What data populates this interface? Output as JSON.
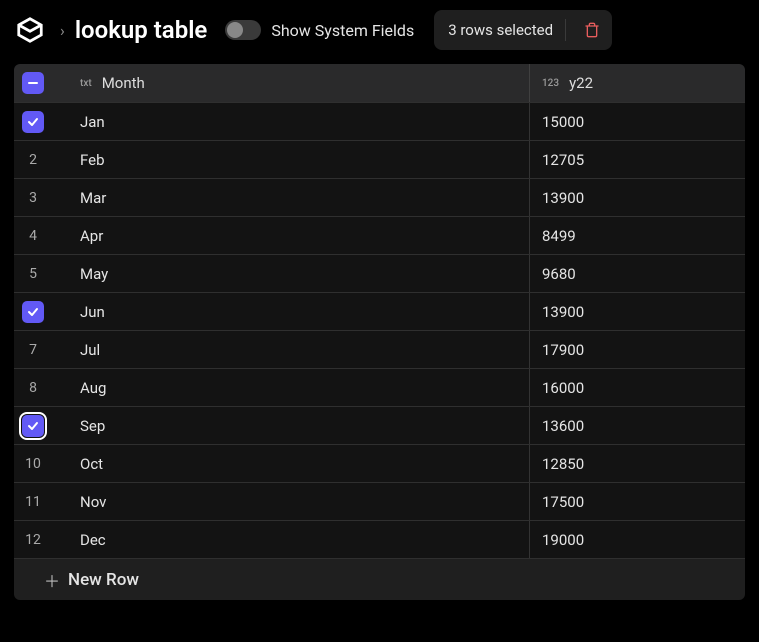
{
  "header": {
    "title": "lookup table",
    "toggle_label": "Show System Fields",
    "selection_text": "3 rows selected"
  },
  "columns": {
    "month": {
      "type_badge": "txt",
      "label": "Month"
    },
    "y22": {
      "type_badge": "123",
      "label": "y22"
    }
  },
  "rows": [
    {
      "idx": 1,
      "checked": true,
      "focused": false,
      "month": "Jan",
      "y22": "15000"
    },
    {
      "idx": 2,
      "checked": false,
      "focused": false,
      "month": "Feb",
      "y22": "12705"
    },
    {
      "idx": 3,
      "checked": false,
      "focused": false,
      "month": "Mar",
      "y22": "13900"
    },
    {
      "idx": 4,
      "checked": false,
      "focused": false,
      "month": "Apr",
      "y22": "8499"
    },
    {
      "idx": 5,
      "checked": false,
      "focused": false,
      "month": "May",
      "y22": "9680"
    },
    {
      "idx": 6,
      "checked": true,
      "focused": false,
      "month": "Jun",
      "y22": "13900"
    },
    {
      "idx": 7,
      "checked": false,
      "focused": false,
      "month": "Jul",
      "y22": "17900"
    },
    {
      "idx": 8,
      "checked": false,
      "focused": false,
      "month": "Aug",
      "y22": "16000"
    },
    {
      "idx": 9,
      "checked": true,
      "focused": true,
      "month": "Sep",
      "y22": "13600"
    },
    {
      "idx": 10,
      "checked": false,
      "focused": false,
      "month": "Oct",
      "y22": "12850"
    },
    {
      "idx": 11,
      "checked": false,
      "focused": false,
      "month": "Nov",
      "y22": "17500"
    },
    {
      "idx": 12,
      "checked": false,
      "focused": false,
      "month": "Dec",
      "y22": "19000"
    }
  ],
  "footer": {
    "new_row_label": "New Row"
  }
}
